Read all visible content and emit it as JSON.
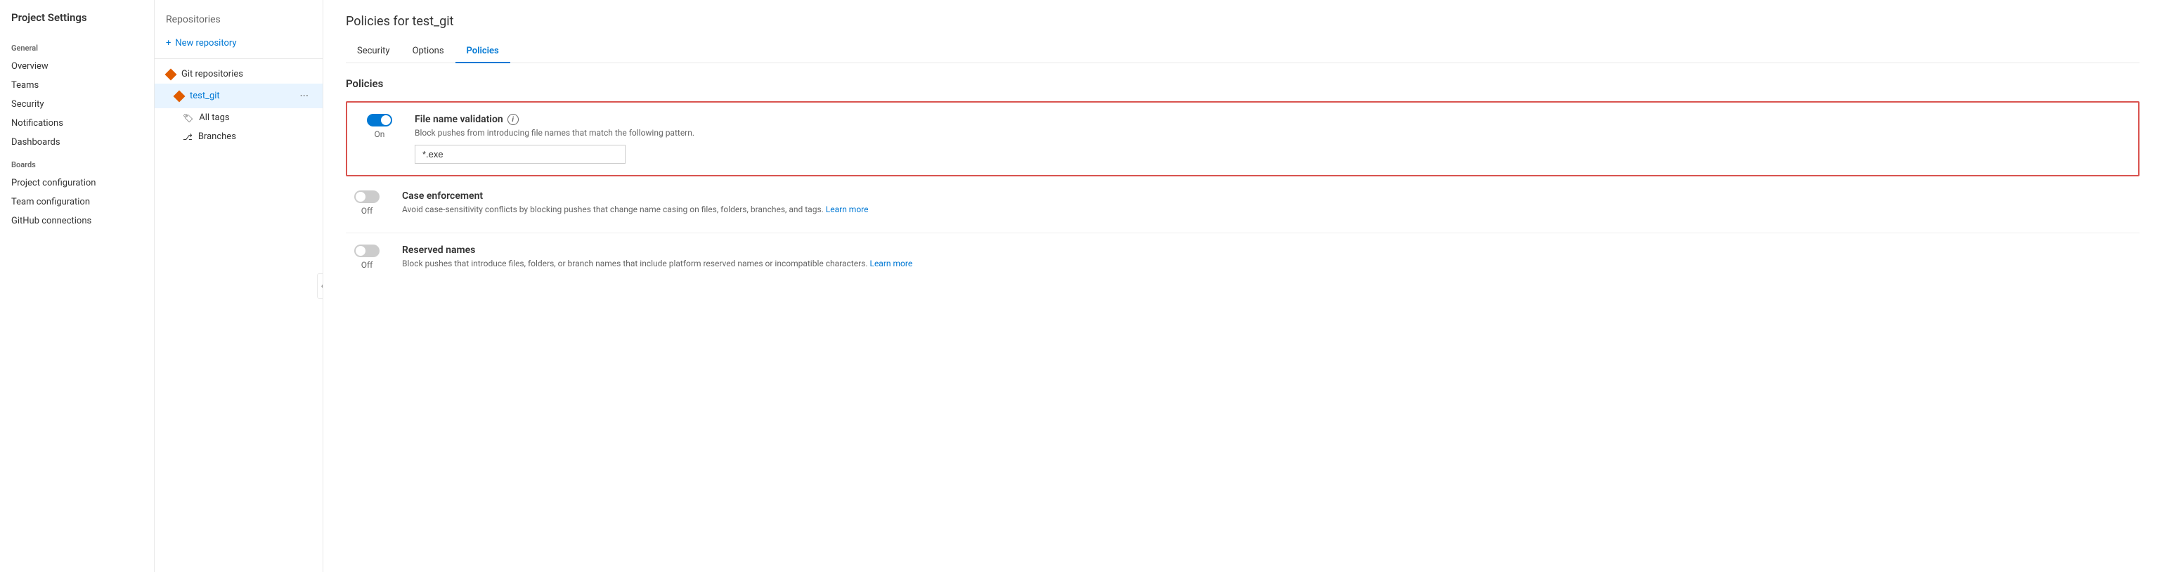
{
  "leftSidebar": {
    "title": "Project Settings",
    "sections": [
      {
        "label": "General",
        "items": [
          "Overview",
          "Teams",
          "Security",
          "Notifications",
          "Dashboards"
        ]
      },
      {
        "label": "Boards",
        "items": [
          "Project configuration",
          "Team configuration",
          "GitHub connections"
        ]
      }
    ]
  },
  "midPanel": {
    "title": "Repositories",
    "newRepoLabel": "New repository",
    "gitReposLabel": "Git repositories",
    "repos": [
      {
        "name": "test_git",
        "active": true,
        "subItems": [
          "All tags",
          "Branches"
        ]
      }
    ]
  },
  "mainContent": {
    "pageTitle": "Policies for test_git",
    "tabs": [
      {
        "label": "Security",
        "active": false
      },
      {
        "label": "Options",
        "active": false
      },
      {
        "label": "Policies",
        "active": true
      }
    ],
    "sectionTitle": "Policies",
    "policies": [
      {
        "id": "file-name-validation",
        "title": "File name validation",
        "hasInfo": true,
        "desc": "Block pushes from introducing file names that match the following pattern.",
        "enabled": true,
        "status": "On",
        "inputValue": "*.exe",
        "highlighted": true
      },
      {
        "id": "case-enforcement",
        "title": "Case enforcement",
        "hasInfo": false,
        "desc": "Avoid case-sensitivity conflicts by blocking pushes that change name casing on files, folders, branches, and tags.",
        "learnMoreText": "Learn more",
        "enabled": false,
        "status": "Off",
        "highlighted": false
      },
      {
        "id": "reserved-names",
        "title": "Reserved names",
        "hasInfo": false,
        "desc": "Block pushes that introduce files, folders, or branch names that include platform reserved names or incompatible characters.",
        "learnMoreText": "Learn more",
        "enabled": false,
        "status": "Off",
        "highlighted": false
      }
    ]
  },
  "icons": {
    "plus": "+",
    "chevronLeft": "❮",
    "ellipsis": "···",
    "tag": "🏷",
    "branch": "⎇",
    "info": "i"
  }
}
